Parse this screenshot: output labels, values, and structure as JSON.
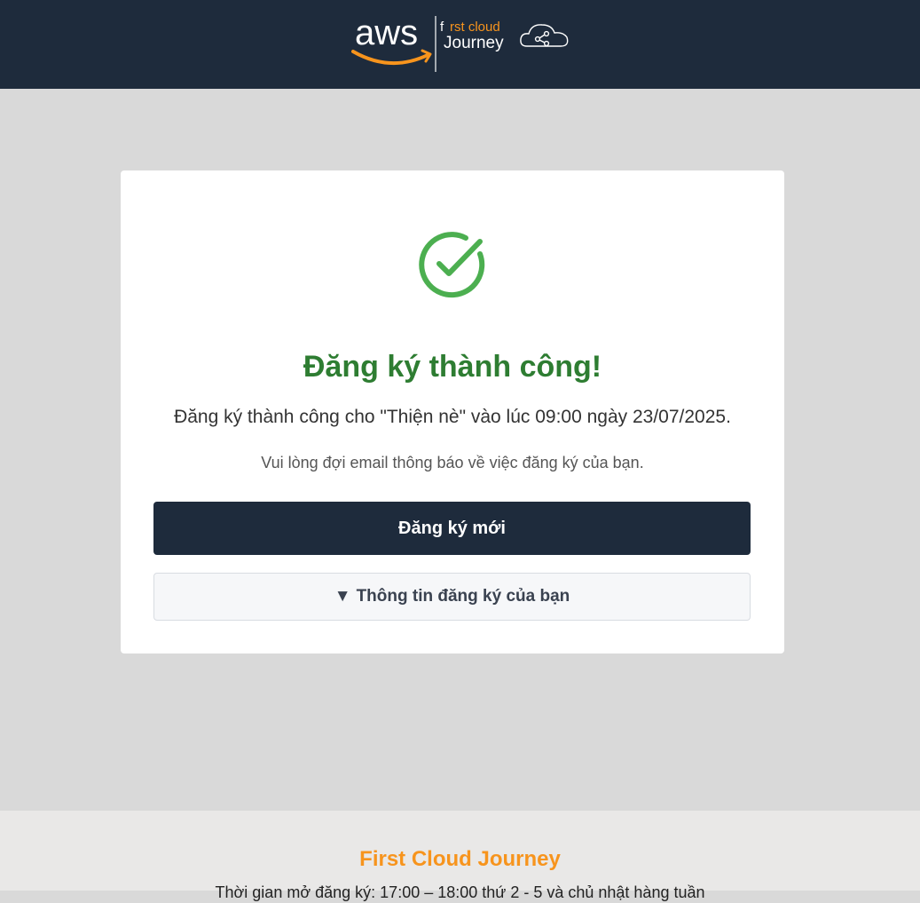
{
  "header": {
    "logo": {
      "aws_text": "aws",
      "brand_line1_a": "f",
      "brand_line1_b": "rst cloud",
      "brand_line2": "Journey",
      "icon": "cloud-network-icon"
    }
  },
  "card": {
    "icon": "check-circle-icon",
    "title": "Đăng ký thành công!",
    "detail": "Đăng ký thành công cho \"Thiện nè\" vào lúc 09:00 ngày 23/07/2025.",
    "note": "Vui lòng đợi email thông báo về việc đăng ký của bạn.",
    "primary_button": "Đăng ký mới",
    "toggle_arrow": "▼",
    "toggle_button": "Thông tin đăng ký của bạn"
  },
  "footer": {
    "title": "First Cloud Journey",
    "text": "Thời gian mở đăng ký: 17:00 – 18:00 thứ 2 - 5 và chủ nhật hàng tuần"
  },
  "colors": {
    "header_bg": "#1e2b3c",
    "success_green": "#2e7d32",
    "check_green": "#4caf50",
    "brand_orange": "#f7941d",
    "page_bg": "#d9d9d9"
  }
}
